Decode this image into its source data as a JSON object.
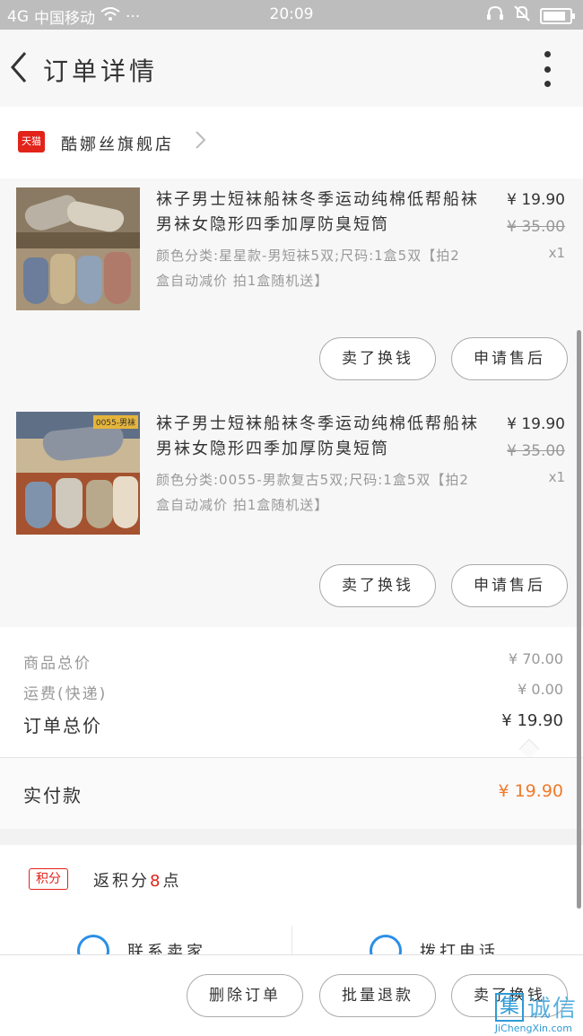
{
  "status_bar": {
    "signal": "4G",
    "carrier": "中国移动",
    "dots": "···",
    "time": "20:09",
    "battery_level": 0.85
  },
  "header": {
    "title": "订单详情"
  },
  "shop": {
    "badge": "天猫",
    "name": "酷娜丝旗舰店"
  },
  "items": [
    {
      "title": "袜子男士短袜船袜冬季运动纯棉低帮船袜男袜女隐形四季加厚防臭短筒",
      "sku": "颜色分类:星星款-男短袜5双;尺码:1盒5双【拍2盒自动减价 拍1盒随机送】",
      "price": "¥ 19.90",
      "original_price": "¥ 35.00",
      "quantity": "x1",
      "thumb_label": "",
      "btn_left": "卖了换钱",
      "btn_right": "申请售后"
    },
    {
      "title": "袜子男士短袜船袜冬季运动纯棉低帮船袜男袜女隐形四季加厚防臭短筒",
      "sku": "颜色分类:0055-男款复古5双;尺码:1盒5双【拍2盒自动减价 拍1盒随机送】",
      "price": "¥ 19.90",
      "original_price": "¥ 35.00",
      "quantity": "x1",
      "thumb_label": "0055-男袜",
      "btn_left": "卖了换钱",
      "btn_right": "申请售后"
    }
  ],
  "totals": {
    "goods_label": "商品总价",
    "goods_value": "¥ 70.00",
    "shipping_label": "运费(快递)",
    "shipping_value": "¥ 0.00",
    "order_label": "订单总价",
    "order_value": "¥ 19.90"
  },
  "paid": {
    "label": "实付款",
    "value": "¥ 19.90"
  },
  "points": {
    "tag": "积分",
    "prefix": "返积分",
    "value": "8",
    "suffix": "点"
  },
  "contact": {
    "seller": "联系卖家",
    "phone": "拨打电话"
  },
  "actions": {
    "delete": "删除订单",
    "batch_refund": "批量退款",
    "sell": "卖了换钱"
  },
  "watermark": {
    "mark": "集",
    "cn": "诚信",
    "en": "JiChengXin.com"
  },
  "colors": {
    "accent_red": "#e2231a",
    "paid_orange": "#f07a2a",
    "phone_blue": "#2b8fe6"
  }
}
